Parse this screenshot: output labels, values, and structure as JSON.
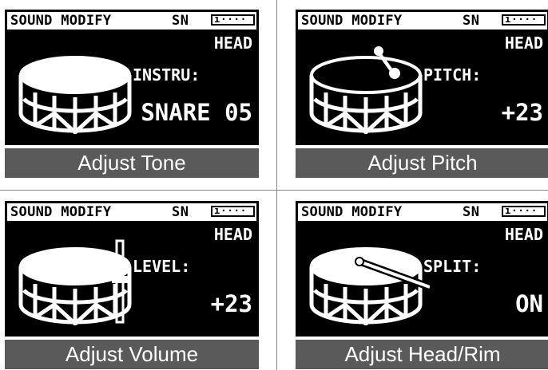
{
  "panels": [
    {
      "header": {
        "title": "SOUND MODIFY",
        "code": "SN",
        "meter": "ı····"
      },
      "position": "HEAD",
      "param_label": "INSTRU:",
      "value": "SNARE 05",
      "caption": "Adjust Tone",
      "icon": "snare-drum-icon"
    },
    {
      "header": {
        "title": "SOUND MODIFY",
        "code": "SN",
        "meter": "ı····"
      },
      "position": "HEAD",
      "param_label": "PITCH:",
      "value": "+23",
      "caption": "Adjust Pitch",
      "icon": "snare-drum-tuning-icon"
    },
    {
      "header": {
        "title": "SOUND MODIFY",
        "code": "SN",
        "meter": "ı····"
      },
      "position": "HEAD",
      "param_label": "LEVEL:",
      "value": "+23",
      "caption": "Adjust Volume",
      "icon": "snare-drum-volume-fader-icon"
    },
    {
      "header": {
        "title": "SOUND MODIFY",
        "code": "SN",
        "meter": "ı····"
      },
      "position": "HEAD",
      "param_label": "SPLIT:",
      "value": "ON",
      "caption": "Adjust Head/Rim",
      "icon": "snare-drum-stick-icon"
    }
  ]
}
